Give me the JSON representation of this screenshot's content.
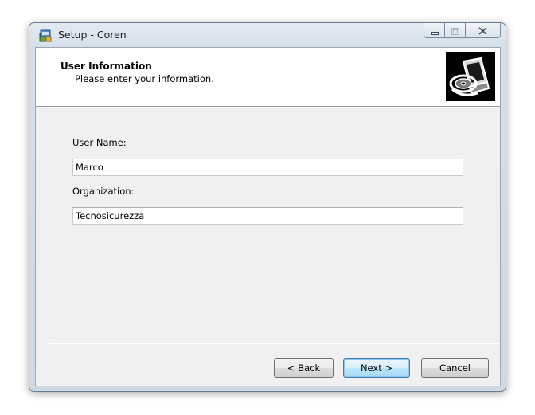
{
  "window": {
    "title": "Setup - Coren",
    "icon": "setup-box-icon",
    "caption_buttons": [
      "minimize-icon",
      "maximize-icon",
      "close-icon"
    ]
  },
  "header": {
    "title": "User Information",
    "subtitle": "Please enter your information.",
    "image": "computer-disc-icon"
  },
  "form": {
    "user_name_label": "User Name:",
    "user_name_value": "Marco",
    "organization_label": "Organization:",
    "organization_value": "Tecnosicurezza"
  },
  "buttons": {
    "back": "< Back",
    "next": "Next >",
    "cancel": "Cancel"
  },
  "colors": {
    "accent_default_button": "#3c7fb1",
    "client_bg": "#f0f0f0",
    "header_bg": "#ffffff"
  }
}
